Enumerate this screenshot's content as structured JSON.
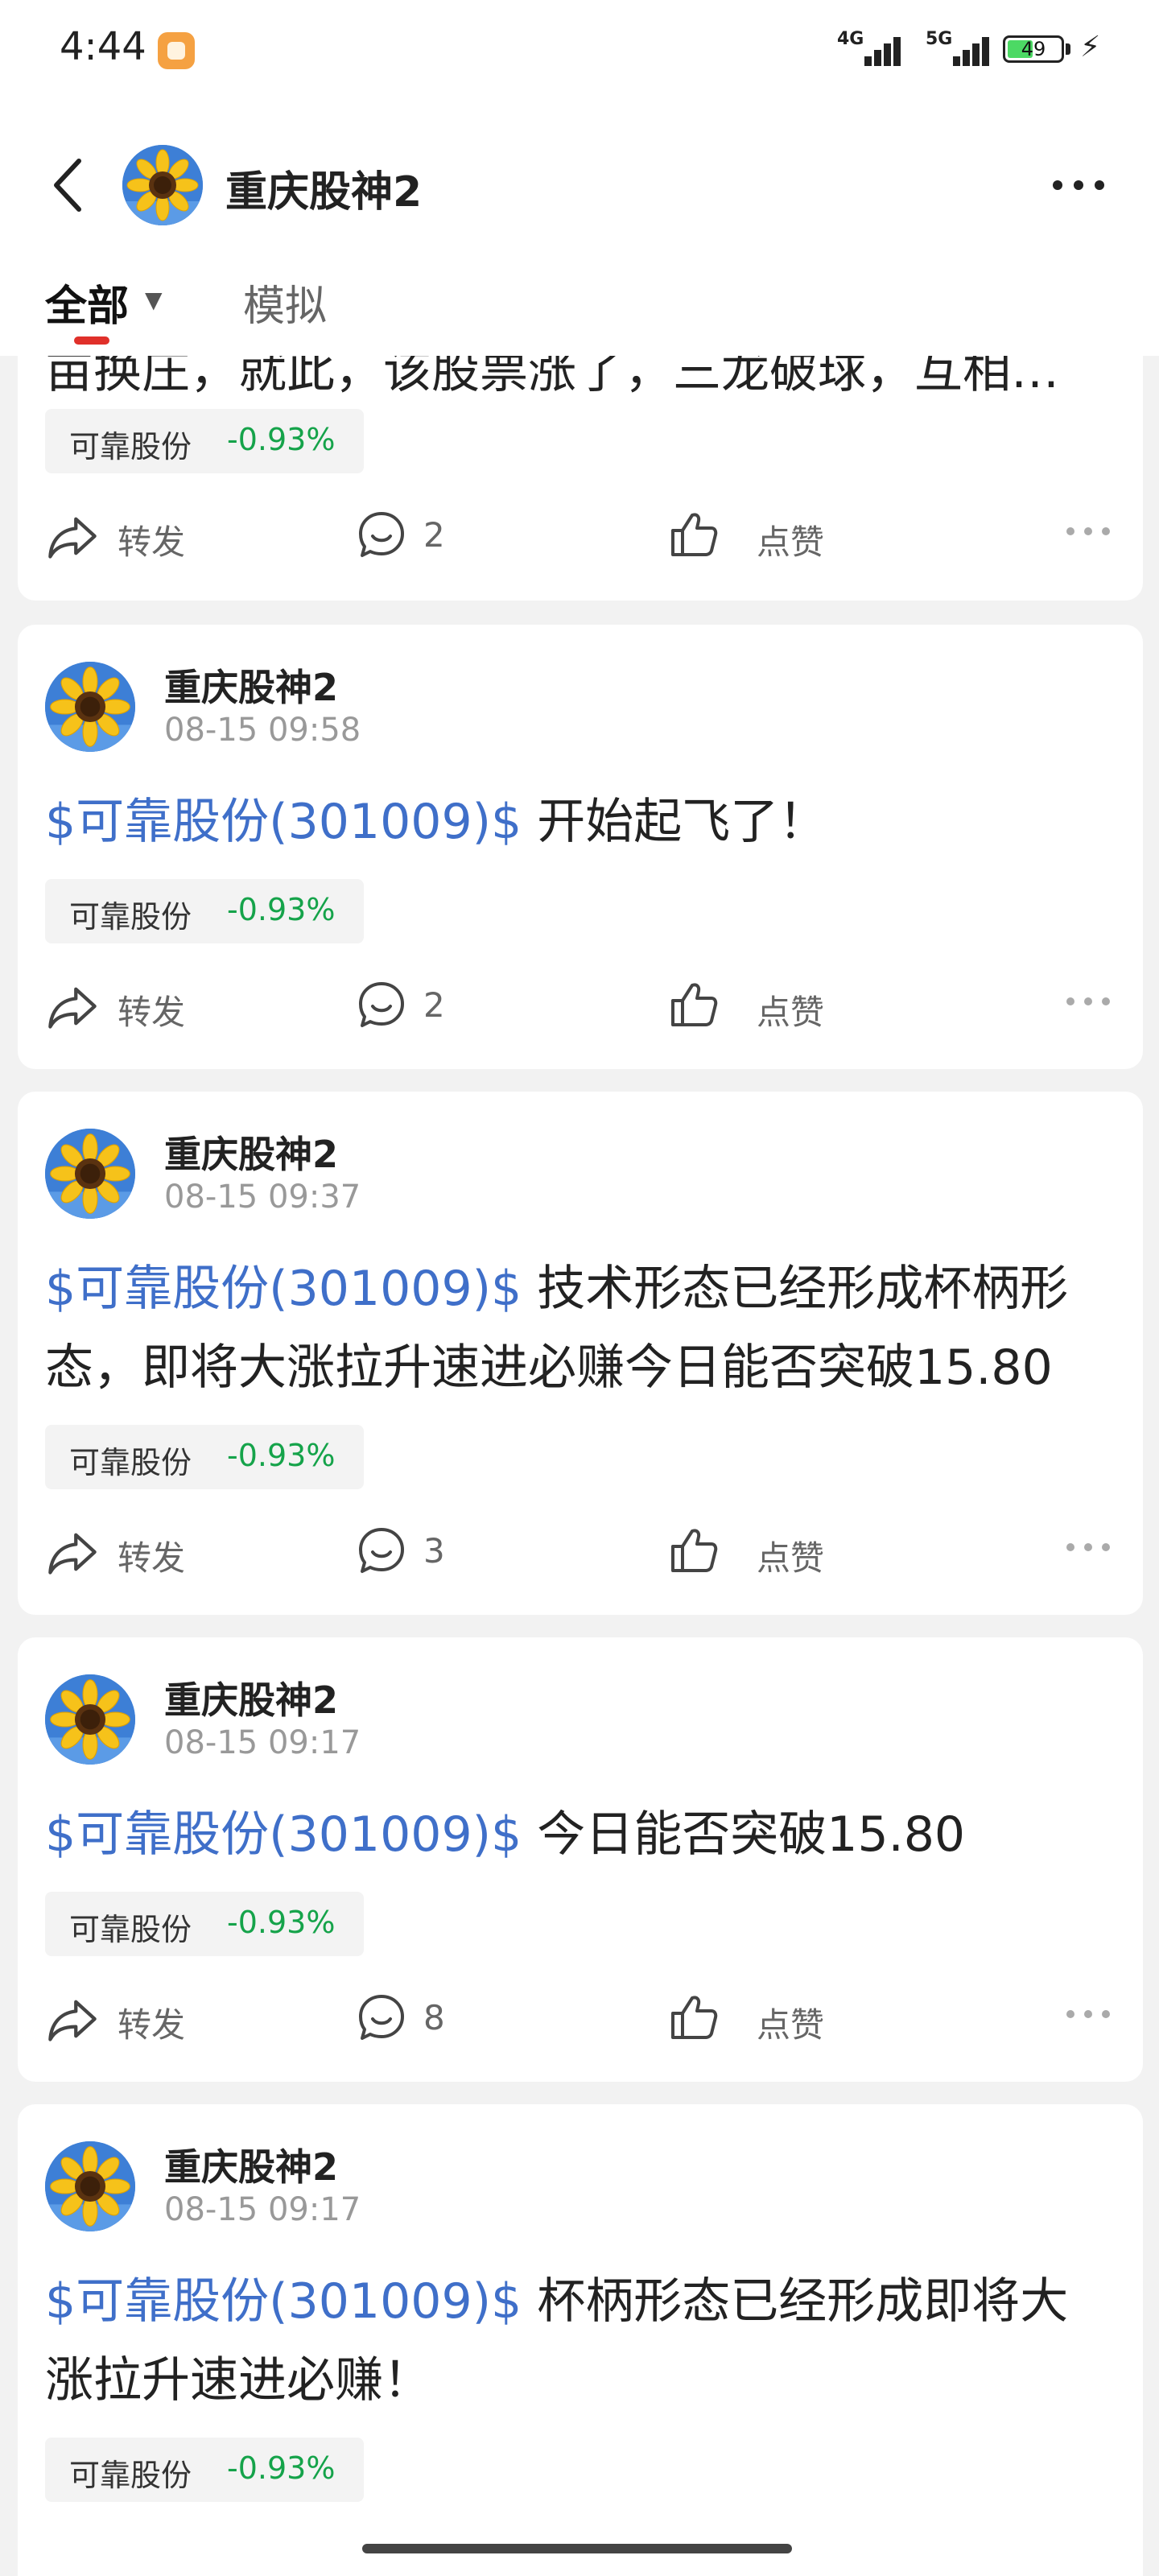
{
  "status": {
    "time": "4:44",
    "net1": "4G",
    "net2": "5G",
    "battery": "49",
    "battery_level": 0.49
  },
  "header": {
    "title": "重庆股神2"
  },
  "tabs": {
    "all_label": "全部",
    "sim_label": "模拟"
  },
  "icons": {
    "back": "chevron-left-icon",
    "more": "more-horizontal-icon",
    "share": "share-arrow-icon",
    "comment": "comment-bubble-icon",
    "like": "thumbs-up-icon",
    "card_more": "more-dots-icon"
  },
  "colors": {
    "link": "#3f6fc9",
    "down": "#15a34a",
    "tab_indicator": "#e0302a",
    "background": "#f2f2f2"
  },
  "actions": {
    "share_label": "转发",
    "like_label": "点赞"
  },
  "partial_post": {
    "cut_text": "亩换庄，就此，该股票涨了，三龙破球，互相…",
    "tag_name": "可靠股份",
    "tag_change": "-0.93%",
    "comments": "2"
  },
  "posts": [
    {
      "author": "重庆股神2",
      "time": "08-15 09:58",
      "stock": "$可靠股份(301009)$",
      "text": "开始起飞了！",
      "tag_name": "可靠股份",
      "tag_change": "-0.93%",
      "comments": "2"
    },
    {
      "author": "重庆股神2",
      "time": "08-15 09:37",
      "stock": "$可靠股份(301009)$",
      "text": "技术形态已经形成杯柄形态，即将大涨拉升速进必赚今日能否突破15.80",
      "tag_name": "可靠股份",
      "tag_change": "-0.93%",
      "comments": "3"
    },
    {
      "author": "重庆股神2",
      "time": "08-15 09:17",
      "stock": "$可靠股份(301009)$",
      "text": "今日能否突破15.80",
      "tag_name": "可靠股份",
      "tag_change": "-0.93%",
      "comments": "8"
    },
    {
      "author": "重庆股神2",
      "time": "08-15 09:17",
      "stock": "$可靠股份(301009)$",
      "text": "杯柄形态已经形成即将大涨拉升速进必赚！",
      "tag_name": "可靠股份",
      "tag_change": "-0.93%"
    }
  ]
}
